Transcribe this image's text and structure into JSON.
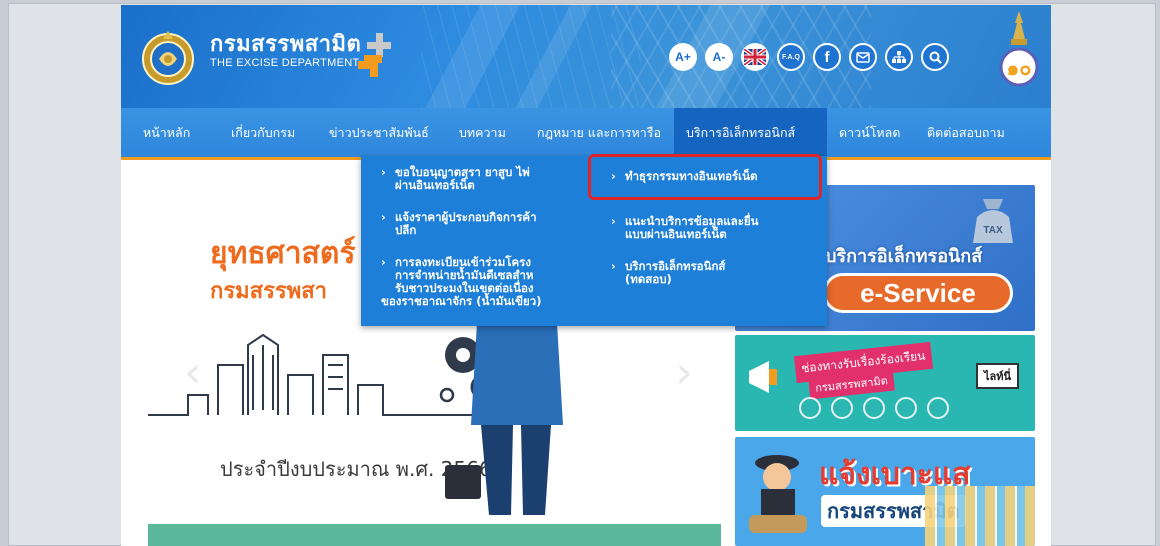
{
  "header": {
    "title": "กรมสรรพสามิต",
    "subtitle": "THE EXCISE DEPARTMENT",
    "tools": [
      {
        "label": "A+",
        "icon": "font-increase-icon"
      },
      {
        "label": "A-",
        "icon": "font-decrease-icon"
      },
      {
        "label": "",
        "icon": "uk-flag-icon"
      },
      {
        "label": "F.A.Q",
        "icon": "faq-icon"
      },
      {
        "label": "f",
        "icon": "facebook-icon"
      },
      {
        "label": "",
        "icon": "mail-icon"
      },
      {
        "label": "",
        "icon": "sitemap-icon"
      },
      {
        "label": "",
        "icon": "search-icon"
      }
    ]
  },
  "nav": {
    "items": [
      {
        "label": "หน้าหลัก"
      },
      {
        "label": "เกี่ยวกับกรม"
      },
      {
        "label": "ข่าวประชาสัมพันธ์"
      },
      {
        "label": "บทความ"
      },
      {
        "label": "กฎหมาย และการหารือ"
      },
      {
        "label": "บริการอิเล็กทรอนิกส์",
        "active": true
      },
      {
        "label": "ดาวน์โหลด"
      },
      {
        "label": "ติดต่อสอบถาม"
      }
    ]
  },
  "dropdown": {
    "left": [
      {
        "lines": [
          "ขอใบอนุญาตสุรา ยาสูบ ไพ่",
          "ผ่านอินเทอร์เน็ต"
        ]
      },
      {
        "lines": [
          "แจ้งราคาผู้ประกอบกิจการค้า",
          "ปลีก"
        ]
      },
      {
        "lines": [
          "การลงทะเบียนเข้าร่วมโครง",
          "การจำหน่ายน้ำมันดีเซลสำห",
          "รับชาวประมงในเขตต่อเนื่อง",
          "ของราชอาณาจักร (น้ำมันเขียว)"
        ]
      }
    ],
    "right": [
      {
        "lines": [
          "ทำธุรกรรมทางอินเทอร์เน็ต"
        ]
      },
      {
        "lines": [
          "แนะนำบริการข้อมูลและยื่น",
          "แบบผ่านอินเทอร์เน็ต"
        ]
      },
      {
        "lines": [
          "บริการอิเล็กทรอนิกส์",
          "(ทดสอบ)"
        ]
      }
    ]
  },
  "slider": {
    "headline": "ยุทธศาสตร์",
    "department": "กรมสรรพสา",
    "fiscal_year": "ประจำปีงบประมาณ พ.ศ. 2566",
    "prev_arrow": "‹",
    "next_arrow": "›"
  },
  "banners": {
    "eservice_title": "บริการอิเล็กทรอนิกส์",
    "eservice_pill": "e-Service",
    "tax_label": "TAX",
    "complaint_title": "ช่องทางรับเรื่องร้องเรียน",
    "complaint_sub": "กรมสรรพสามิต",
    "line_badge": "ไลท์นี่",
    "report_title": "แจ้งเบาะแส",
    "report_sub": "กรมสรรพสามิต"
  },
  "colors": {
    "header_blue": "#2d8be0",
    "nav_blue": "#3b93e3",
    "nav_active": "#1565c0",
    "accent_orange": "#f29b1f",
    "dropdown_blue": "#1e7fd9",
    "highlight_red": "#e0252a",
    "headline_orange": "#ee6a1c"
  }
}
